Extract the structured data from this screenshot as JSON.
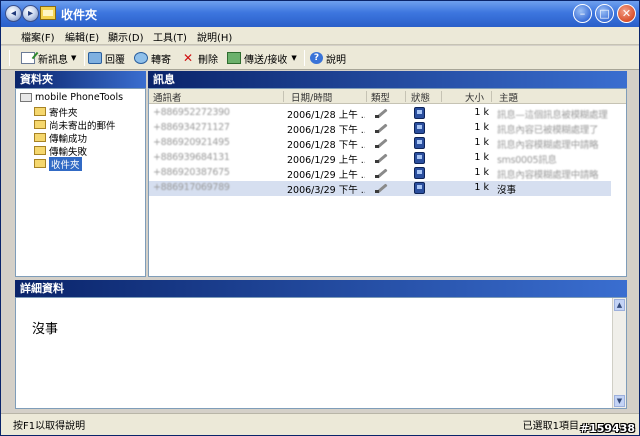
{
  "window": {
    "title": "收件夾"
  },
  "menu": [
    "檔案(F)",
    "編輯(E)",
    "顯示(D)",
    "工具(T)",
    "說明(H)"
  ],
  "toolbar": {
    "new_message": "新訊息",
    "reply": "回覆",
    "forward": "轉寄",
    "delete": "刪除",
    "send_receive": "傳送/接收",
    "help": "說明"
  },
  "folders": {
    "title": "資料夾",
    "root": "mobile PhoneTools",
    "items": [
      "寄件夾",
      "尚未寄出的郵件",
      "傳輸成功",
      "傳輸失敗",
      "收件夾"
    ],
    "selected": "收件夾"
  },
  "messages": {
    "title": "訊息",
    "columns": [
      "通訊者",
      "日期/時間",
      "類型",
      "狀態",
      "大小",
      "主題"
    ],
    "rows": [
      {
        "contact": "+886952272390",
        "datetime": "2006/1/28 上午 ...",
        "size": "1 k",
        "subject": "訊息—這個訊息被模糊處理"
      },
      {
        "contact": "+886934271127",
        "datetime": "2006/1/28 下午 ...",
        "size": "1 k",
        "subject": "訊息內容已被模糊處理了"
      },
      {
        "contact": "+886920921495",
        "datetime": "2006/1/28 下午 ...",
        "size": "1 k",
        "subject": "訊息內容模糊處理中請略"
      },
      {
        "contact": "+886939684131",
        "datetime": "2006/1/29 上午 ...",
        "size": "1 k",
        "subject": "sms0005訊息"
      },
      {
        "contact": "+886920387675",
        "datetime": "2006/1/29 上午 ...",
        "size": "1 k",
        "subject": "訊息內容模糊處理中請略"
      },
      {
        "contact": "+886917069789",
        "datetime": "2006/3/29 下午 ...",
        "size": "1 k",
        "subject": "沒事"
      }
    ],
    "selected_index": 5
  },
  "details": {
    "title": "詳細資料",
    "body": "沒事"
  },
  "status": {
    "left": "按F1以取得說明",
    "right": "已選取1項目"
  },
  "watermark": "#159438"
}
